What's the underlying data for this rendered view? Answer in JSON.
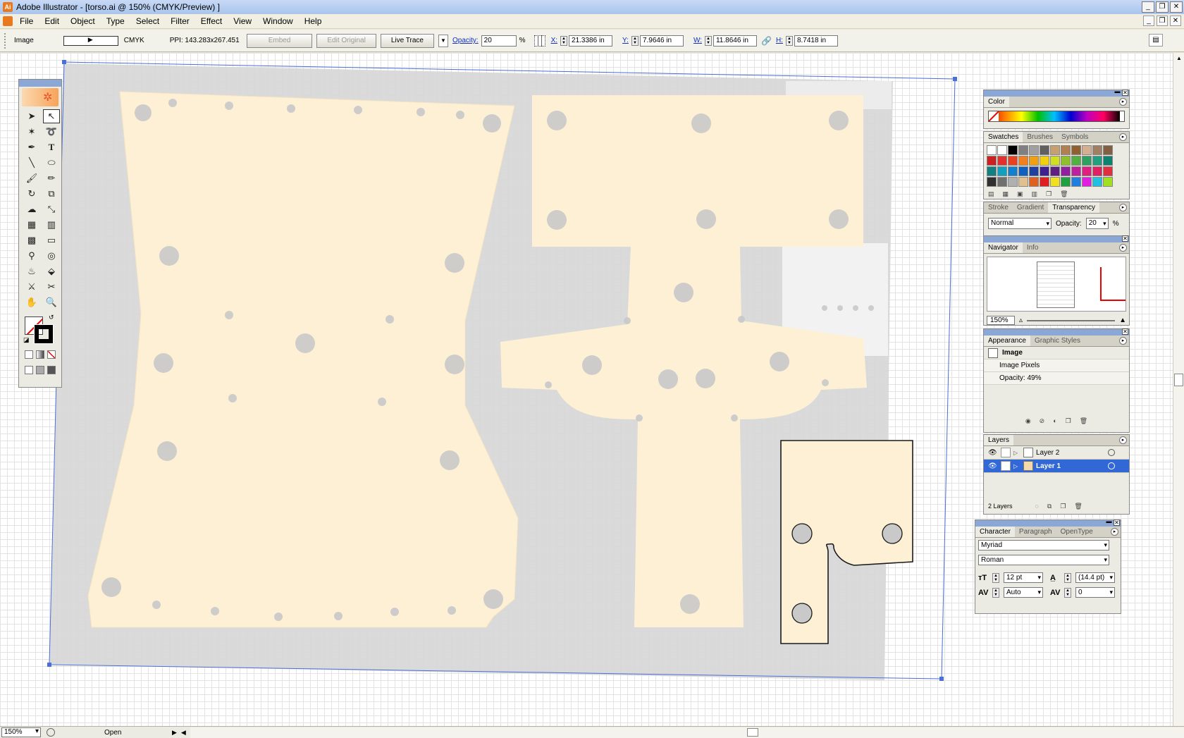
{
  "window": {
    "title": "Adobe Illustrator - [torso.ai @ 150% (CMYK/Preview) ]"
  },
  "menu": [
    "File",
    "Edit",
    "Object",
    "Type",
    "Select",
    "Filter",
    "Effect",
    "View",
    "Window",
    "Help"
  ],
  "control": {
    "object_type": "Image",
    "color_mode": "CMYK",
    "ppi": "PPI: 143.283x267.451",
    "embed": "Embed",
    "edit_original": "Edit Original",
    "live_trace": "Live Trace",
    "opacity_label": "Opacity:",
    "opacity_value": "20",
    "pct": "%",
    "x_label": "X:",
    "x_value": "21.3386 in",
    "y_label": "Y:",
    "y_value": "7.9646 in",
    "w_label": "W:",
    "w_value": "11.8646 in",
    "h_label": "H:",
    "h_value": "8.7418 in"
  },
  "status": {
    "zoom": "150%",
    "text": "Open"
  },
  "panels": {
    "color": {
      "tab": "Color"
    },
    "swatches": {
      "tabs": [
        "Swatches",
        "Brushes",
        "Symbols"
      ],
      "colors": [
        "#ffffff",
        "#ffffff",
        "#000000",
        "#808080",
        "#a0a0a0",
        "#606060",
        "#c8a070",
        "#b08050",
        "#906030",
        "#d4b090",
        "#a08060",
        "#806040",
        "#cc2020",
        "#e03030",
        "#e84020",
        "#f08020",
        "#f0a010",
        "#f0d010",
        "#d0e020",
        "#90c030",
        "#50b040",
        "#30a060",
        "#20a080",
        "#108070",
        "#108080",
        "#10a0c0",
        "#1080d0",
        "#1060c0",
        "#2040a0",
        "#402090",
        "#602080",
        "#9020a0",
        "#c020a0",
        "#e02080",
        "#e02060",
        "#e03040",
        "#303030",
        "#707070",
        "#b0b0b0",
        "#e0c090",
        "#e06020",
        "#e02020",
        "#f0e020",
        "#20a040",
        "#2080e0",
        "#e020e0",
        "#20c0e0",
        "#a0e020"
      ]
    },
    "transparency": {
      "tabs": [
        "Stroke",
        "Gradient",
        "Transparency"
      ],
      "blend": "Normal",
      "opacity_label": "Opacity:",
      "opacity_value": "20",
      "pct": "%"
    },
    "navigator": {
      "tabs": [
        "Navigator",
        "Info"
      ],
      "zoom": "150%"
    },
    "appearance": {
      "tabs": [
        "Appearance",
        "Graphic Styles"
      ],
      "title": "Image",
      "items": [
        "Image Pixels",
        "Opacity: 49%"
      ]
    },
    "layers": {
      "tab": "Layers",
      "items": [
        {
          "name": "Layer 2",
          "selected": false
        },
        {
          "name": "Layer 1",
          "selected": true
        }
      ],
      "count": "2 Layers"
    },
    "character": {
      "tabs": [
        "Character",
        "Paragraph",
        "OpenType"
      ],
      "font": "Myriad",
      "style": "Roman",
      "size": "12 pt",
      "leading": "(14.4 pt)",
      "kerning": "Auto",
      "tracking": "0"
    }
  },
  "colors": {
    "piece_fill": "#fdf0d5",
    "shadow": "#d4d4d4",
    "selection": "#4a6fd8",
    "outline": "#1a1a1a",
    "hole": "#c9c9c9"
  }
}
